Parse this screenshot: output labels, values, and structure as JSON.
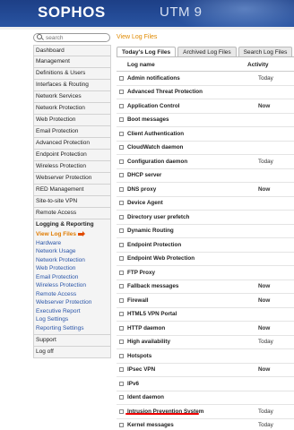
{
  "header": {
    "logo": "SOPHOS",
    "product": "UTM 9"
  },
  "search": {
    "placeholder": "search"
  },
  "breadcrumb": "View Log Files",
  "sidebar": {
    "items": [
      "Dashboard",
      "Management",
      "Definitions & Users",
      "Interfaces & Routing",
      "Network Services",
      "Network Protection",
      "Web Protection",
      "Email Protection",
      "Advanced Protection",
      "Endpoint Protection",
      "Wireless Protection",
      "Webserver Protection",
      "RED Management",
      "Site-to-site VPN",
      "Remote Access"
    ],
    "group": {
      "title": "Logging & Reporting",
      "subitems": [
        "View Log Files",
        "Hardware",
        "Network Usage",
        "Network Protection",
        "Web Protection",
        "Email Protection",
        "Wireless Protection",
        "Remote Access",
        "Webserver Protection",
        "Executive Report",
        "Log Settings",
        "Reporting Settings"
      ]
    },
    "bottom": [
      "Support",
      "Log off"
    ]
  },
  "tabs": [
    "Today's Log Files",
    "Archived Log Files",
    "Search Log Files"
  ],
  "table": {
    "headers": {
      "name": "Log name",
      "activity": "Activity"
    },
    "rows": [
      {
        "name": "Admin notifications",
        "activity": "Today"
      },
      {
        "name": "Advanced Threat Protection",
        "activity": ""
      },
      {
        "name": "Application Control",
        "activity": "Now"
      },
      {
        "name": "Boot messages",
        "activity": ""
      },
      {
        "name": "Client Authentication",
        "activity": ""
      },
      {
        "name": "CloudWatch daemon",
        "activity": ""
      },
      {
        "name": "Configuration daemon",
        "activity": "Today"
      },
      {
        "name": "DHCP server",
        "activity": ""
      },
      {
        "name": "DNS proxy",
        "activity": "Now"
      },
      {
        "name": "Device Agent",
        "activity": ""
      },
      {
        "name": "Directory user prefetch",
        "activity": ""
      },
      {
        "name": "Dynamic Routing",
        "activity": ""
      },
      {
        "name": "Endpoint Protection",
        "activity": ""
      },
      {
        "name": "Endpoint Web Protection",
        "activity": ""
      },
      {
        "name": "FTP Proxy",
        "activity": ""
      },
      {
        "name": "Fallback messages",
        "activity": "Now"
      },
      {
        "name": "Firewall",
        "activity": "Now"
      },
      {
        "name": "HTML5 VPN Portal",
        "activity": ""
      },
      {
        "name": "HTTP daemon",
        "activity": "Now"
      },
      {
        "name": "High availability",
        "activity": "Today"
      },
      {
        "name": "Hotspots",
        "activity": ""
      },
      {
        "name": "IPsec VPN",
        "activity": "Now"
      },
      {
        "name": "IPv6",
        "activity": ""
      },
      {
        "name": "Ident daemon",
        "activity": ""
      },
      {
        "name": "Intrusion Prevention System",
        "activity": "Today"
      },
      {
        "name": "Kernel messages",
        "activity": "Today"
      }
    ]
  },
  "colors": {
    "header_bg": "#1d3f86",
    "accent_orange": "#e07b00",
    "link_blue": "#2a55a8",
    "highlight_red": "#e00000"
  }
}
